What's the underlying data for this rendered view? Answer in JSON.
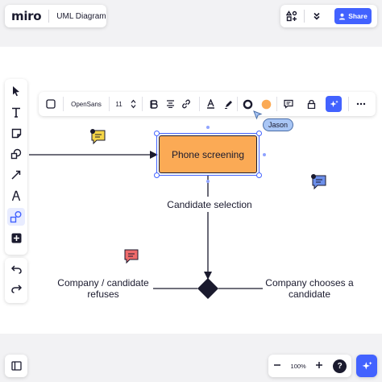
{
  "app": {
    "logo_text": "miro",
    "board_title": "UML Diagram"
  },
  "header": {
    "share_label": "Share",
    "icons": [
      "shapes-plus-icon",
      "double-chevron-down-icon",
      "user-icon"
    ]
  },
  "left_toolbar": {
    "tools": [
      {
        "name": "select",
        "icon": "cursor-icon"
      },
      {
        "name": "text",
        "icon": "text-icon"
      },
      {
        "name": "sticky-note",
        "icon": "sticky-note-icon"
      },
      {
        "name": "shapes",
        "icon": "shapes-icon"
      },
      {
        "name": "connection-line",
        "icon": "arrow-line-icon"
      },
      {
        "name": "pen",
        "icon": "pen-icon"
      },
      {
        "name": "diagram-shapes",
        "icon": "diagram-shapes-icon",
        "active": true
      },
      {
        "name": "add-more",
        "icon": "plus-square-icon"
      }
    ],
    "undo_icon": "undo-icon",
    "redo_icon": "redo-icon"
  },
  "context_toolbar": {
    "font_family": "OpenSans",
    "font_size": "11",
    "fill_color": "#fbaa55",
    "border_color": "#1a1a2e"
  },
  "diagram": {
    "shape_label": "Phone screening",
    "shape_fill": "#fbaa55",
    "edge_label_selection": "Candidate selection",
    "left_label_line1": "Company / candidate",
    "left_label_line2": "refuses",
    "right_label_line1": "Company chooses a",
    "right_label_line2": "candidate"
  },
  "collaborator": {
    "name": "Jason",
    "color": "#a9c6f5"
  },
  "comments": [
    {
      "color": "#f5d547",
      "icon": "comment-icon"
    },
    {
      "color": "#6c8fea",
      "icon": "comment-icon"
    },
    {
      "color": "#ef6b6b",
      "icon": "comment-icon"
    }
  ],
  "bottom": {
    "zoom_level": "100%",
    "help_label": "?",
    "accent": "#4262ff"
  }
}
